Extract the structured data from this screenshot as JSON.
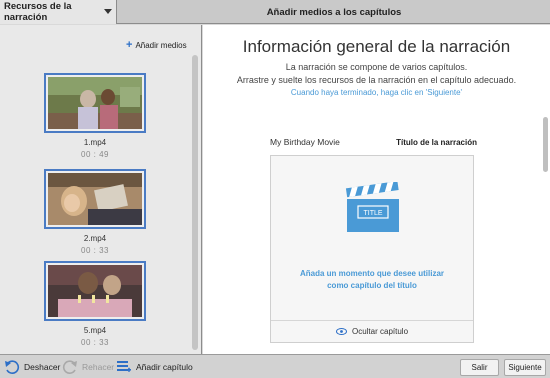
{
  "tabs": [
    {
      "label": "Recursos de la narración"
    },
    {
      "label": "Añadir medios a los capítulos"
    }
  ],
  "left": {
    "add_media_label": "Añadir medios",
    "clips": [
      {
        "name": "1.mp4",
        "duration": "00 : 49"
      },
      {
        "name": "2.mp4",
        "duration": "00 : 33"
      },
      {
        "name": "5.mp4",
        "duration": "00 : 33"
      }
    ]
  },
  "main": {
    "title": "Información general de la narración",
    "line1": "La narración se compone de varios capítulos.",
    "line2": "Arrastre y suelte los recursos de la narración en el capítulo adecuado.",
    "hint": "Cuando haya terminado, haga clic en 'Siguiente'",
    "movie_name": "My Birthday Movie",
    "chapter_label": "Título de la narración",
    "clapper_text": "TITLE",
    "chapter_message_1": "Añada un momento que desee utilizar",
    "chapter_message_2": "como capítulo del título",
    "hide_chapter": "Ocultar capítulo"
  },
  "bottom": {
    "undo": "Deshacer",
    "redo": "Rehacer",
    "add_chapter": "Añadir capítulo",
    "exit": "Salir",
    "next": "Siguiente"
  },
  "colors": {
    "accent": "#4a9ad6",
    "thumb_border": "#4a7bc4",
    "clapper": "#4a9ad6"
  }
}
